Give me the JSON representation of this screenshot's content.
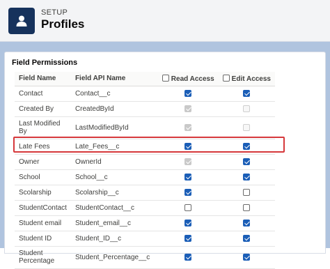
{
  "header": {
    "breadcrumb": "SETUP",
    "title": "Profiles"
  },
  "section": {
    "title": "Field Permissions"
  },
  "table": {
    "columns": {
      "field_name": "Field Name",
      "field_api_name": "Field API Name",
      "read_access": "Read Access",
      "edit_access": "Edit Access"
    },
    "rows": [
      {
        "name": "Contact",
        "api": "Contact__c",
        "read": "checked",
        "edit": "checked"
      },
      {
        "name": "Created By",
        "api": "CreatedById",
        "read": "checked-disabled",
        "edit": "unchecked-disabled"
      },
      {
        "name": "Last Modified By",
        "api": "LastModifiedById",
        "read": "checked-disabled",
        "edit": "unchecked-disabled"
      },
      {
        "name": "Late Fees",
        "api": "Late_Fees__c",
        "read": "checked",
        "edit": "checked"
      },
      {
        "name": "Owner",
        "api": "OwnerId",
        "read": "checked-disabled",
        "edit": "checked"
      },
      {
        "name": "School",
        "api": "School__c",
        "read": "checked",
        "edit": "checked"
      },
      {
        "name": "Scolarship",
        "api": "Scolarship__c",
        "read": "checked",
        "edit": "unchecked"
      },
      {
        "name": "StudentContact",
        "api": "StudentContact__c",
        "read": "unchecked",
        "edit": "unchecked"
      },
      {
        "name": "Student email",
        "api": "Student_email__c",
        "read": "checked",
        "edit": "checked"
      },
      {
        "name": "Student ID",
        "api": "Student_ID__c",
        "read": "checked",
        "edit": "checked"
      },
      {
        "name": "Student Percentage",
        "api": "Student_Percentage__c",
        "read": "checked",
        "edit": "checked"
      }
    ]
  },
  "colors": {
    "highlight": "#d6383b",
    "checkbox_checked": "#1b5eb7",
    "header_icon": "#16325c"
  },
  "icons": {
    "header": "user-icon"
  }
}
